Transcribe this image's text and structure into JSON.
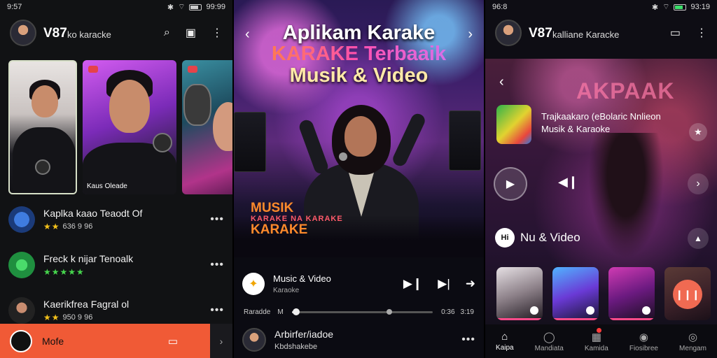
{
  "panel1": {
    "status": {
      "time": "9:57",
      "right": "99:99"
    },
    "header": {
      "brand": "V87",
      "subtitle": "ko karacke",
      "search_icon": "search-icon",
      "cast_icon": "cast-icon",
      "menu_icon": "more-vert-icon"
    },
    "cards": [
      {
        "label": ""
      },
      {
        "label": "Kaus Oleade"
      },
      {
        "label": ""
      }
    ],
    "songs": [
      {
        "title": "Kaplka kaao Teaodt Of",
        "sub": "636 9 96",
        "stars": "★★",
        "star_color": "gold"
      },
      {
        "title": "Freck k nijar Tenoalk",
        "sub": "",
        "stars": "★★★★★",
        "star_color": "green"
      },
      {
        "title": "Kaerikfrea Fagral ol",
        "sub": "950 9 96",
        "stars": "★★",
        "star_color": "gold"
      }
    ],
    "bottom": {
      "label": "Mofe"
    }
  },
  "panel2": {
    "hero": {
      "line1": "Aplikam Karake",
      "line2": "KARAKE Terbaaik",
      "line3": "Musik & Video"
    },
    "neon": {
      "line1": "MUSIK",
      "line2": "KARAKE NA KARAKE",
      "line3": "KARAKE"
    },
    "player": {
      "title": "Music & Video",
      "subtitle": "Karaoke"
    },
    "progress": {
      "left_label": "Raradde",
      "mid_label": "M",
      "time_elapsed": "0:36",
      "time_total": "3:19",
      "fraction": 0.03
    },
    "next_song": {
      "title": "Arbirfer/iadoe",
      "subtitle": "Kbdshakebe"
    }
  },
  "panel3": {
    "status": {
      "time": "96:8",
      "right": "93:19"
    },
    "header": {
      "brand": "V87",
      "subtitle": "kalliane Karacke"
    },
    "hero_title": "AKPAAK",
    "app": {
      "title": "Trajkaakaro (eBolaric Nnlieon",
      "subtitle": "Musik & Karaoke"
    },
    "section": {
      "icon_text": "Hi",
      "title": "Nu & Video"
    },
    "nav": [
      {
        "label": "Kaipa",
        "icon": "home-icon"
      },
      {
        "label": "Mandiata",
        "icon": "search-icon"
      },
      {
        "label": "Kamida",
        "icon": "library-icon"
      },
      {
        "label": "Fiosibree",
        "icon": "bell-icon"
      },
      {
        "label": "Mengam",
        "icon": "profile-icon"
      }
    ]
  }
}
